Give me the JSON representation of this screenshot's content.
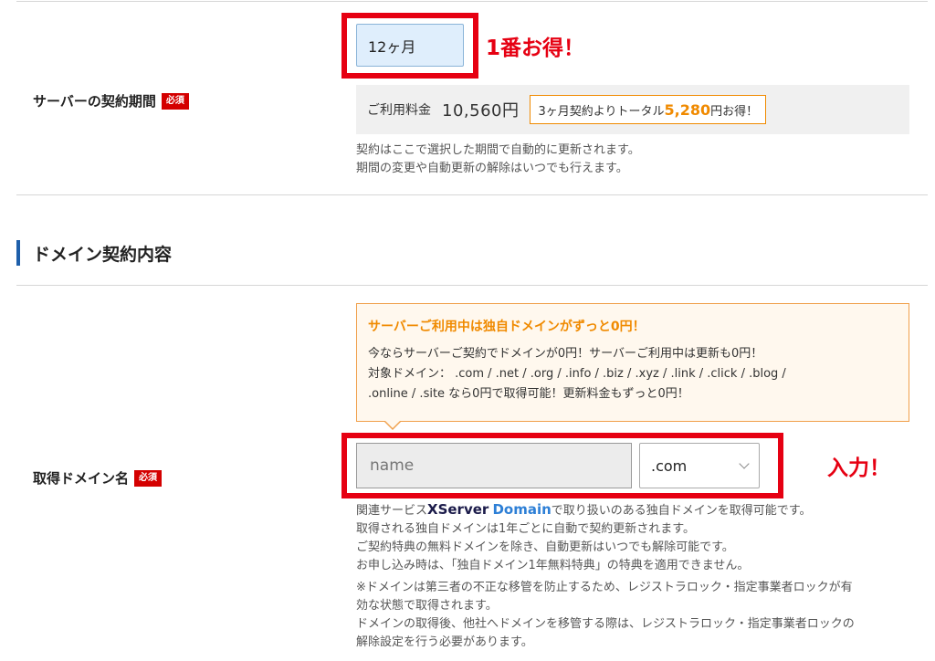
{
  "server_period": {
    "label": "サーバーの契約期間",
    "required": "必須",
    "selected": "12ヶ月",
    "callout": "1番お得！",
    "price_label": "ご利用料金",
    "price_value": "10,560円",
    "savings_prefix": "3ヶ月契約よりトータル",
    "savings_amount": "5,280",
    "savings_suffix": "円お得！",
    "note_1": "契約はここで選択した期間で自動的に更新されます。",
    "note_2": "期間の変更や自動更新の解除はいつでも行えます。"
  },
  "section": {
    "title": "ドメイン契約内容"
  },
  "domain": {
    "label": "取得ドメイン名",
    "required": "必須",
    "promo_title": "サーバーご利用中は独自ドメインがずっと0円！",
    "promo_line_1": "今ならサーバーご契約でドメインが0円！サーバーご利用中は更新も0円！",
    "promo_line_2": "対象ドメイン： .com / .net / .org / .info / .biz / .xyz / .link / .click / .blog /",
    "promo_line_3": ".online / .site なら0円で取得可能！更新料金もずっと0円！",
    "input_placeholder": "name",
    "tld_selected": ".com",
    "callout": "入力！",
    "note_prefix": "関連サービス",
    "brand_x": "XServer",
    "brand_domain": "Domain",
    "note_line_1_suffix": "で取り扱いのある独自ドメインを取得可能です。",
    "note_line_2": "取得される独自ドメインは1年ごとに自動で契約更新されます。",
    "note_line_3": "ご契約特典の無料ドメインを除き、自動更新はいつでも解除可能です。",
    "note_line_4": "お申し込み時は、「独自ドメイン1年無料特典」の特典を適用できません。",
    "warn_line_1": "※ドメインは第三者の不正な移管を防止するため、レジストラロック・指定事業者ロックが有",
    "warn_line_2": "効な状態で取得されます。",
    "warn_line_3": "ドメインの取得後、他社へドメインを移管する際は、レジストラロック・指定事業者ロックの",
    "warn_line_4": "解除設定を行う必要があります。"
  },
  "colors": {
    "highlight_red": "#e60012",
    "accent_orange": "#f08a00",
    "section_blue": "#1e5faa"
  }
}
